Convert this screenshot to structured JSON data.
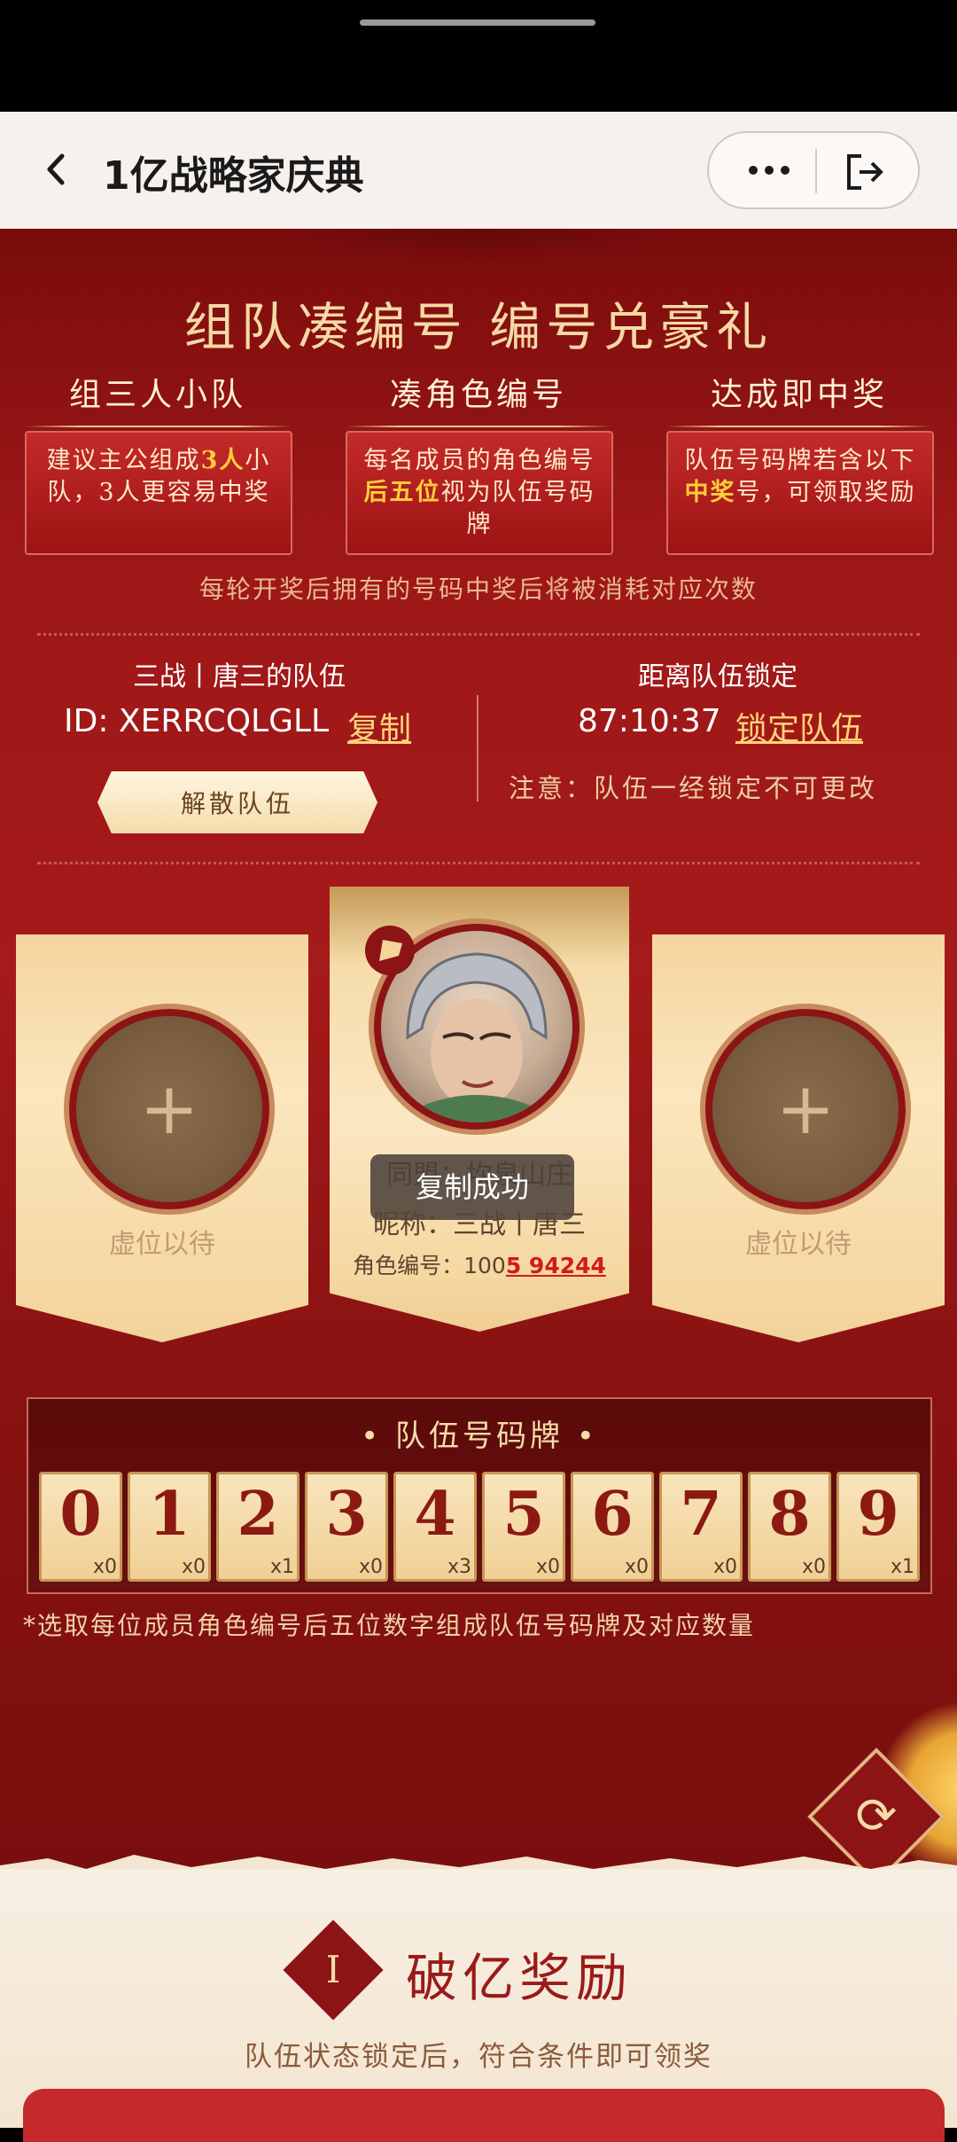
{
  "nav": {
    "title": "1亿战略家庆典",
    "back_icon": "chevron-left-icon",
    "more_icon": "more-dots-icon",
    "exit_icon": "exit-icon"
  },
  "header": {
    "headline": "组队凑编号  编号兑豪礼",
    "steps": [
      {
        "title": "组三人小队",
        "desc_parts": [
          "建议主公组成",
          "3人",
          "小队，3人更容易中奖"
        ]
      },
      {
        "title": "凑角色编号",
        "desc_parts": [
          "每名成员的角色编号",
          "后五位",
          "视为队伍号码牌"
        ]
      },
      {
        "title": "达成即中奖",
        "desc_parts": [
          "队伍号码牌若含以下",
          "中奖",
          "号，可领取奖励"
        ]
      }
    ],
    "hint": "每轮开奖后拥有的号码中奖后将被消耗对应次数"
  },
  "team": {
    "name": "三战丨唐三的队伍",
    "id_text": "ID: XERRCQLGLL",
    "copy_label": "复制",
    "disband_label": "解散队伍",
    "lock_label": "距离队伍锁定",
    "countdown": "87:10:37",
    "lock_button": "锁定队伍",
    "note": "注意：队伍一经锁定不可更改"
  },
  "members": {
    "empty_label": "虚位以待",
    "center": {
      "line1": "同盟：坎泉山庄",
      "nickname": "昵称：三战丨唐三",
      "id_prefix": "角色编号：",
      "id_plain": "100",
      "id_highlight": "5 94244",
      "toast": "复制成功"
    }
  },
  "board": {
    "title": "• 队伍号码牌 •",
    "tiles": [
      {
        "digit": "0",
        "count": "x0"
      },
      {
        "digit": "1",
        "count": "x0"
      },
      {
        "digit": "2",
        "count": "x1"
      },
      {
        "digit": "3",
        "count": "x0"
      },
      {
        "digit": "4",
        "count": "x3"
      },
      {
        "digit": "5",
        "count": "x0"
      },
      {
        "digit": "6",
        "count": "x0"
      },
      {
        "digit": "7",
        "count": "x0"
      },
      {
        "digit": "8",
        "count": "x0"
      },
      {
        "digit": "9",
        "count": "x1"
      }
    ],
    "footnote": "*选取每位成员角色编号后五位数字组成队伍号码牌及对应数量"
  },
  "rewards": {
    "roman": "I",
    "title": "破亿奖励",
    "subtitle": "队伍状态锁定后，符合条件即可领奖"
  },
  "colors": {
    "accent_gold": "#ffd27a",
    "highlight_red": "#d11b1b",
    "bg_red": "#a51a1a"
  }
}
